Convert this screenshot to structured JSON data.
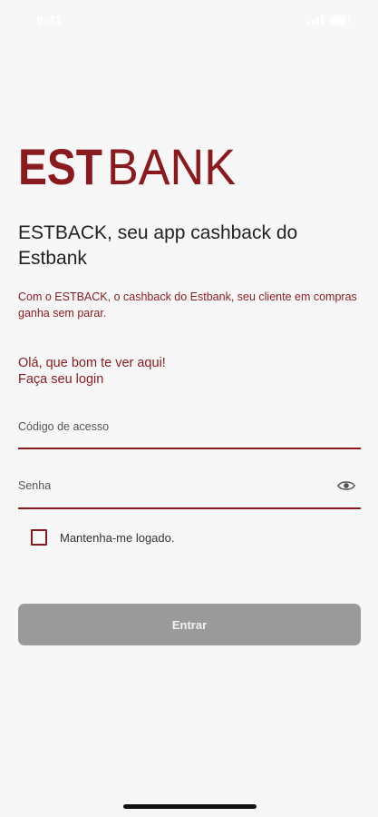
{
  "status_bar": {
    "time": "9:41"
  },
  "brand": {
    "logo_text_left": "EST",
    "logo_text_right": "BANK",
    "primary_color": "#8b1a1f"
  },
  "content": {
    "headline": "ESTBACK, seu app cashback do Estbank",
    "description": "Com o ESTBACK, o cashback do Estbank, seu cliente em compras ganha sem parar.",
    "greeting_line1": "Olá, que bom te ver aqui!",
    "greeting_line2": "Faça seu login"
  },
  "form": {
    "access_code_placeholder": "Código de acesso",
    "access_code_value": "",
    "password_placeholder": "Senha",
    "password_value": "",
    "password_toggle_icon": "eye-icon",
    "keep_logged_label": "Mantenha-me logado.",
    "keep_logged_checked": false,
    "submit_label": "Entrar"
  }
}
